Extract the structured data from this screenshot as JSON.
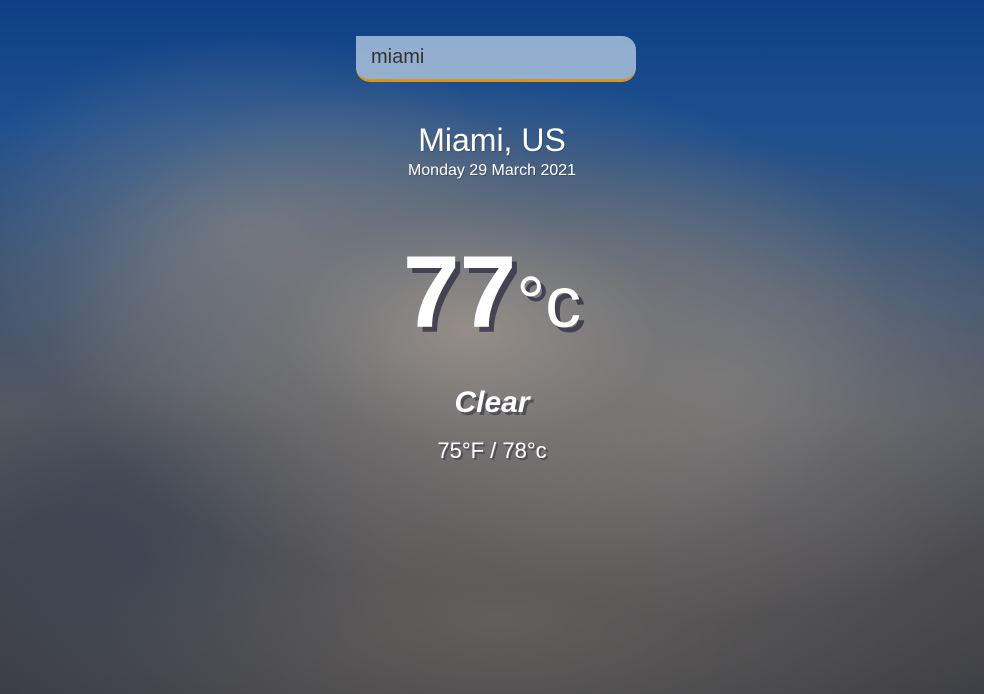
{
  "search": {
    "value": "miami"
  },
  "location": {
    "city": "Miami, US",
    "date": "Monday 29 March 2021"
  },
  "current": {
    "temperature": "77",
    "unit": "°c",
    "condition": "Clear",
    "hi_low": "75°F / 78°c"
  }
}
